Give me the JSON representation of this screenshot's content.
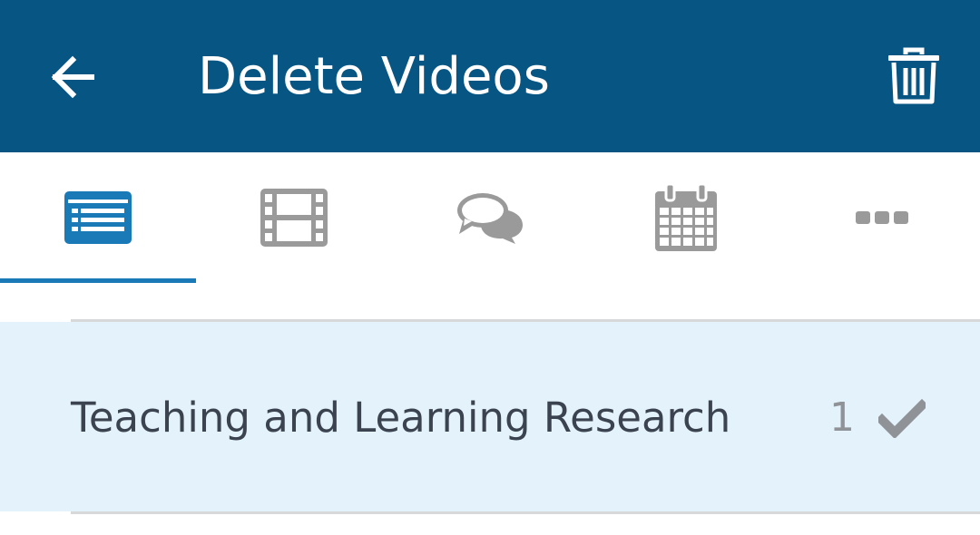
{
  "header": {
    "title": "Delete Videos",
    "back_icon": "arrow-left-icon",
    "delete_icon": "trash-icon",
    "background_color": "#075583"
  },
  "tabs": [
    {
      "icon": "list-icon",
      "active": true
    },
    {
      "icon": "film-icon",
      "active": false
    },
    {
      "icon": "chat-bubbles-icon",
      "active": false
    },
    {
      "icon": "calendar-icon",
      "active": false
    },
    {
      "icon": "more-icon",
      "active": false
    }
  ],
  "accent_color": "#1a7ab8",
  "list": {
    "items": [
      {
        "label": "Teaching and Learning Research",
        "count": "1",
        "selected": true,
        "status_icon": "checkmark-icon"
      }
    ]
  }
}
